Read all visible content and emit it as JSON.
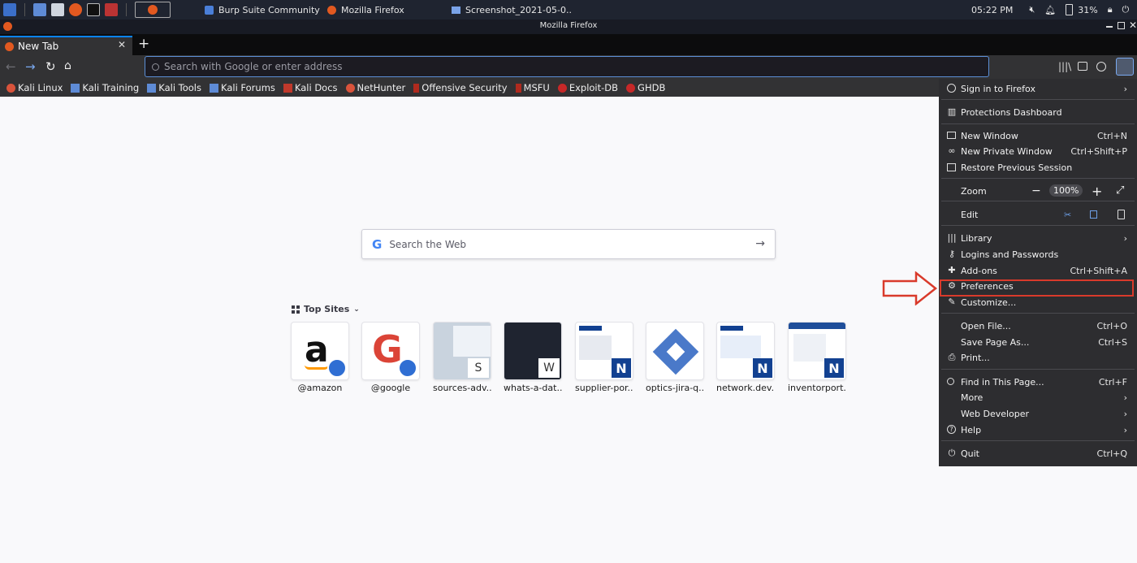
{
  "taskbar": {
    "tasks": [
      "Burp Suite Community E...",
      "Mozilla Firefox",
      "Screenshot_2021-05-0..."
    ],
    "time": "05:22 PM",
    "battery": "31%"
  },
  "window": {
    "title": "Mozilla Firefox"
  },
  "tab": {
    "label": "New Tab"
  },
  "urlbar": {
    "placeholder": "Search with Google or enter address"
  },
  "bookmarks": [
    "Kali Linux",
    "Kali Training",
    "Kali Tools",
    "Kali Forums",
    "Kali Docs",
    "NetHunter",
    "Offensive Security",
    "MSFU",
    "Exploit-DB",
    "GHDB"
  ],
  "newtab": {
    "search_placeholder": "Search the Web",
    "top_sites_title": "Top Sites",
    "sites": [
      "@amazon",
      "@google",
      "sources-adv...",
      "whats-a-dat...",
      "supplier-por...",
      "optics-jira-q...",
      "network.dev...",
      "inventorport..."
    ],
    "site_letters": {
      "sources": "S",
      "whats": "W"
    },
    "nokia_letter": "N"
  },
  "menu": {
    "sign_in": "Sign in to Firefox",
    "protections": "Protections Dashboard",
    "new_window": "New Window",
    "new_window_sc": "Ctrl+N",
    "private_window": "New Private Window",
    "private_window_sc": "Ctrl+Shift+P",
    "restore": "Restore Previous Session",
    "zoom": "Zoom",
    "zoom_minus": "−",
    "zoom_level": "100%",
    "zoom_plus": "+",
    "edit": "Edit",
    "library": "Library",
    "logins": "Logins and Passwords",
    "addons": "Add-ons",
    "addons_sc": "Ctrl+Shift+A",
    "preferences": "Preferences",
    "customize": "Customize...",
    "open_file": "Open File...",
    "open_file_sc": "Ctrl+O",
    "save_page": "Save Page As...",
    "save_page_sc": "Ctrl+S",
    "print": "Print...",
    "find": "Find in This Page...",
    "find_sc": "Ctrl+F",
    "more": "More",
    "web_dev": "Web Developer",
    "help": "Help",
    "quit": "Quit",
    "quit_sc": "Ctrl+Q"
  },
  "colors": {
    "accent": "#0a84ff",
    "highlight": "#d93a2b",
    "menu_bg": "#2d2d30"
  }
}
